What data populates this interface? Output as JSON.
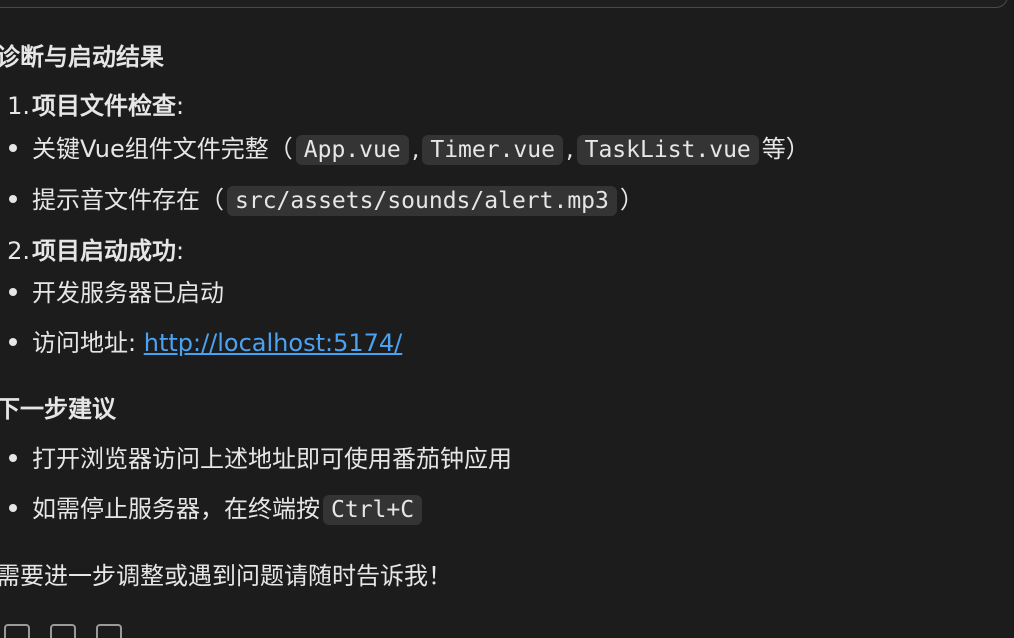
{
  "sections": {
    "diagnosis_heading": "诊断与启动结果",
    "item1": {
      "number": "1.",
      "title": "项目文件检查",
      "suffix": ":",
      "bullets": {
        "b1_text": "关键Vue组件文件完整（",
        "b1_code1": "App.vue",
        "b1_sep1": ",",
        "b1_code2": "Timer.vue",
        "b1_sep2": ",",
        "b1_code3": "TaskList.vue",
        "b1_tail": "等）",
        "b2_text": "提示音文件存在（",
        "b2_code": "src/assets/sounds/alert.mp3",
        "b2_tail": "）"
      }
    },
    "item2": {
      "number": "2.",
      "title": "项目启动成功",
      "suffix": ":",
      "bullets": {
        "b1_text": "开发服务器已启动",
        "b2_text": "访问地址:",
        "b2_link": "http://localhost:5174/"
      }
    },
    "next_heading": "下一步建议",
    "next_bullets": {
      "b1_text": "打开浏览器访问上述地址即可使用番茄钟应用",
      "b2_text": "如需停止服务器，在终端按",
      "b2_code": "Ctrl+C"
    },
    "closing": "需要进一步调整或遇到问题请随时告诉我！"
  },
  "footer": {
    "icons": [
      "copy-icon",
      "thumbs-up-icon",
      "clipboard-icon"
    ]
  }
}
